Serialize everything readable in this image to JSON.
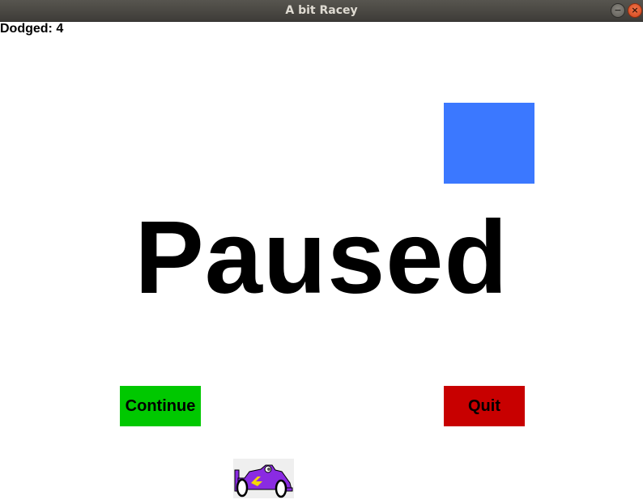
{
  "window": {
    "title": "A bit Racey",
    "minimize_symbol": "−",
    "close_symbol": "×"
  },
  "hud": {
    "score_text": "Dodged: 4"
  },
  "overlay": {
    "message": "Paused"
  },
  "buttons": {
    "continue_label": "Continue",
    "quit_label": "Quit"
  },
  "colors": {
    "obstacle": "#3b78ff",
    "continue": "#00c800",
    "quit": "#c80000",
    "car_body": "#8a2be2",
    "car_stripe": "#f5d800"
  },
  "icons": {
    "player": "race-car-icon"
  }
}
